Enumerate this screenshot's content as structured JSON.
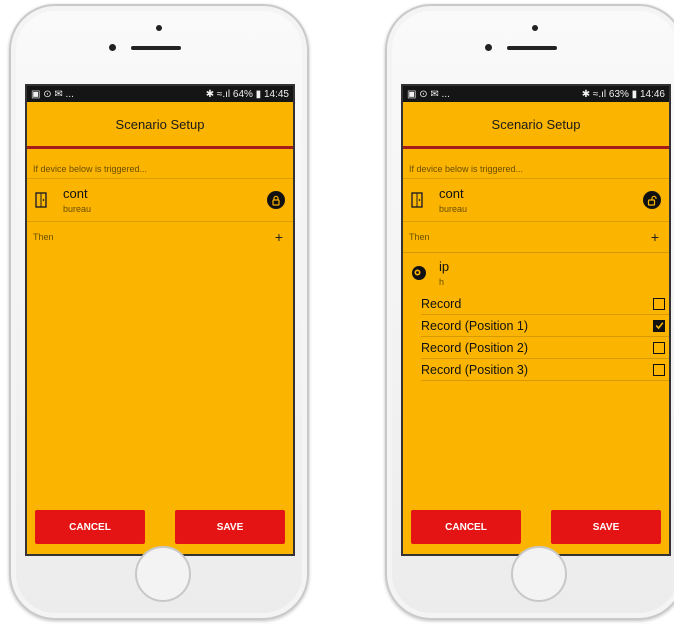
{
  "left": {
    "status": {
      "left_icons": "▣ ⊙ ✉ ...",
      "right": "✱ ≈.ıl 64% ▮ 14:45"
    },
    "title": "Scenario Setup",
    "trigger_hint": "If device below is triggered...",
    "device": {
      "name": "cont",
      "room": "bureau",
      "icon": "door-icon",
      "state_icon": "lock-closed-icon"
    },
    "then_label": "Then",
    "add_symbol": "+",
    "cancel": "CANCEL",
    "save": "SAVE"
  },
  "right": {
    "status": {
      "left_icons": "▣ ⊙ ✉ ...",
      "right": "✱ ≈.ıl 63% ▮ 14:46"
    },
    "title": "Scenario Setup",
    "trigger_hint": "If device below is triggered...",
    "device": {
      "name": "cont",
      "room": "bureau",
      "icon": "door-icon",
      "state_icon": "lock-open-icon"
    },
    "then_label": "Then",
    "add_symbol": "+",
    "action": {
      "name": "ip",
      "sub": "h",
      "icon": "camera-eye-icon"
    },
    "options": [
      {
        "label": "Record",
        "checked": false
      },
      {
        "label": "Record (Position 1)",
        "checked": true
      },
      {
        "label": "Record (Position 2)",
        "checked": false
      },
      {
        "label": "Record (Position 3)",
        "checked": false
      }
    ],
    "cancel": "CANCEL",
    "save": "SAVE"
  },
  "colors": {
    "app_bg": "#fbb400",
    "header_rule": "#a51a1a",
    "button": "#e51414"
  }
}
